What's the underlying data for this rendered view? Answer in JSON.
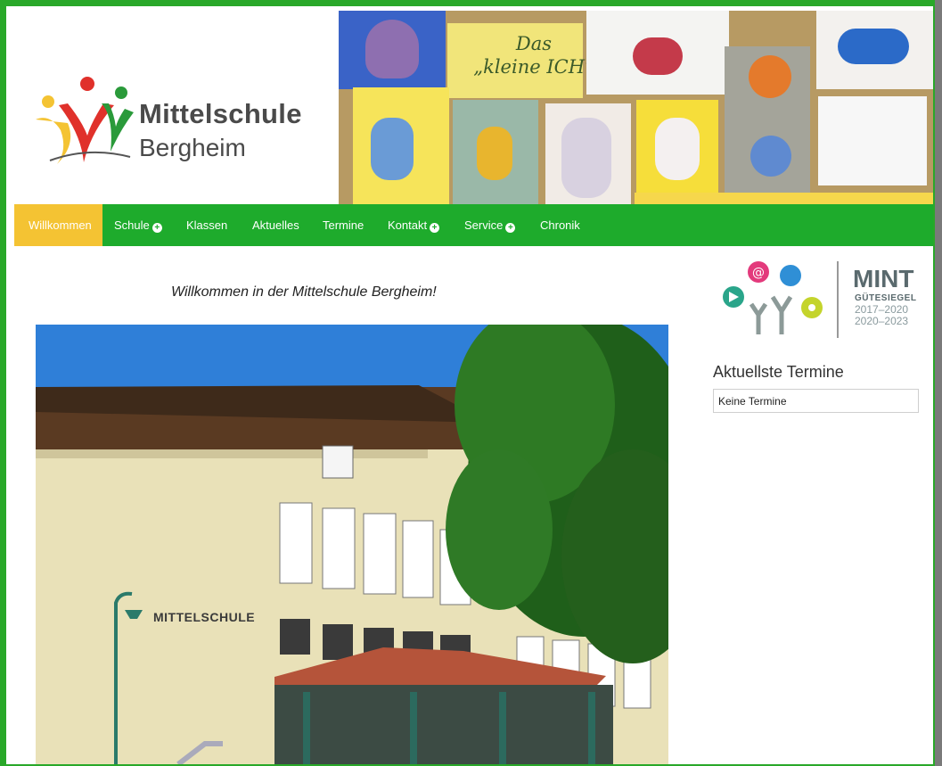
{
  "header": {
    "logo_line1": "Mittelschule",
    "logo_line2": "Bergheim",
    "banner_text_1": "Das",
    "banner_text_2": "„kleine ICH“"
  },
  "nav": {
    "items": [
      {
        "label": "Willkommen",
        "active": true
      },
      {
        "label": "Schule",
        "has_submenu": true
      },
      {
        "label": "Klassen"
      },
      {
        "label": "Aktuelles"
      },
      {
        "label": "Termine"
      },
      {
        "label": "Kontakt",
        "has_submenu": true
      },
      {
        "label": "Service",
        "has_submenu": true
      },
      {
        "label": "Chronik"
      }
    ],
    "submenu_icon": "plus-circle-icon"
  },
  "main": {
    "welcome": "Willkommen in der Mittelschule Bergheim!",
    "building_sign": "MITTELSCHULE"
  },
  "sidebar": {
    "mint_title": "MINT",
    "mint_subtitle": "GÜTESIEGEL",
    "mint_years_1a": "2017",
    "mint_years_1b": "2020",
    "mint_years_2a": "2020",
    "mint_years_2b": "2023",
    "termine_heading": "Aktuellste Termine",
    "termine_value": "Keine Termine"
  },
  "colors": {
    "frame_green": "#29a829",
    "nav_green": "#1eab2c",
    "active_yellow": "#f4c333"
  }
}
